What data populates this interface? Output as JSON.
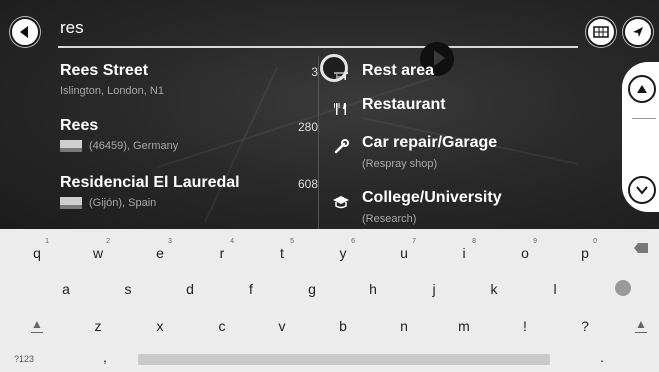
{
  "search": {
    "query": "res"
  },
  "icons": {
    "back": "back-arrow-icon",
    "map": "map-icon",
    "navigation": "navigation-arrow-icon",
    "scroll_up": "chevron-up-icon",
    "scroll_down": "chevron-down-icon"
  },
  "results": [
    {
      "name": "Rees Street",
      "subtitle": "Islington, London, N1",
      "distance": "3",
      "has_flag": false
    },
    {
      "name": "Rees",
      "subtitle": "(46459), Germany",
      "distance": "280",
      "has_flag": true
    },
    {
      "name": "Residencial El Lauredal",
      "subtitle": "(Gijón), Spain",
      "distance": "608",
      "has_flag": true
    }
  ],
  "categories": [
    {
      "label": "Rest area",
      "subtitle": "",
      "icon": "rest-area-icon"
    },
    {
      "label": "Restaurant",
      "subtitle": "",
      "icon": "restaurant-icon"
    },
    {
      "label": "Car repair/Garage",
      "subtitle": "(Respray shop)",
      "icon": "wrench-icon"
    },
    {
      "label": "College/University",
      "subtitle": "(Research)",
      "icon": "graduation-cap-icon"
    }
  ],
  "keyboard": {
    "row1": [
      {
        "key": "q",
        "hint": "1"
      },
      {
        "key": "w",
        "hint": "2"
      },
      {
        "key": "e",
        "hint": "3"
      },
      {
        "key": "r",
        "hint": "4"
      },
      {
        "key": "t",
        "hint": "5"
      },
      {
        "key": "y",
        "hint": "6"
      },
      {
        "key": "u",
        "hint": "7"
      },
      {
        "key": "i",
        "hint": "8"
      },
      {
        "key": "o",
        "hint": "9"
      },
      {
        "key": "p",
        "hint": "0"
      }
    ],
    "row2": [
      "a",
      "s",
      "d",
      "f",
      "g",
      "h",
      "j",
      "k",
      "l"
    ],
    "row3": [
      "z",
      "x",
      "c",
      "v",
      "b",
      "n",
      "m",
      "!",
      "?"
    ],
    "symbols_label": "?123",
    "comma": ",",
    "period": "."
  },
  "colors": {
    "background": "#2a2a2a",
    "text": "#ffffff",
    "subtext": "#a8a8a8",
    "keyboard": "#ececec"
  }
}
